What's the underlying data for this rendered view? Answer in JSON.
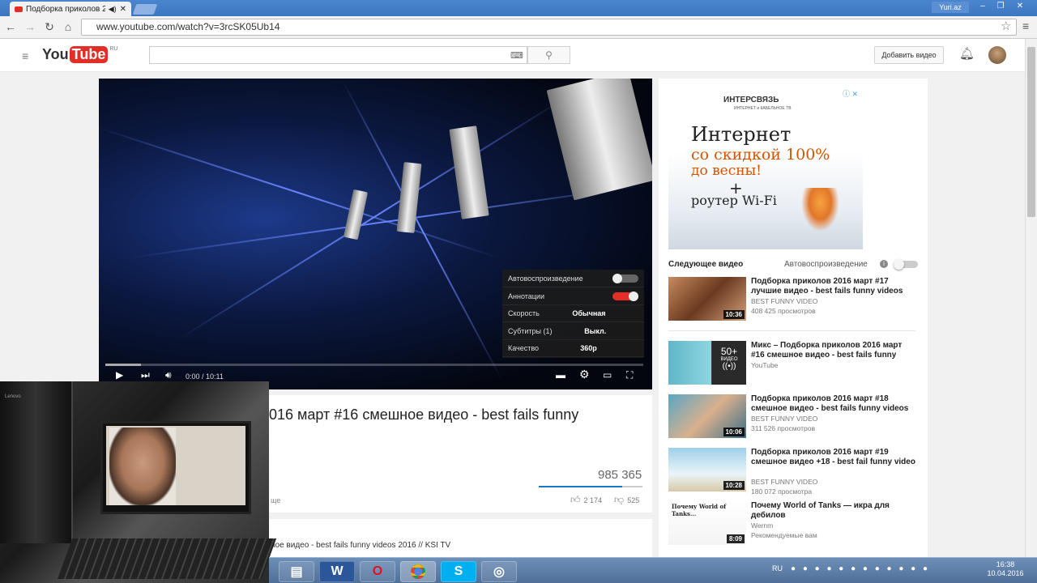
{
  "browser": {
    "tab_title": "Подборка приколов 2",
    "url": "www.youtube.com/watch?v=3rcSK05Ub14",
    "window_user": "Yuri.az"
  },
  "youtube": {
    "logo_you": "You",
    "logo_tube": "Tube",
    "logo_region": "RU",
    "search_placeholder": "",
    "upload_label": "Добавить видео"
  },
  "player": {
    "time": "0:00 / 10:11",
    "progress_fraction": 0.066,
    "settings": [
      {
        "label": "Автовоспроизведение",
        "value": "",
        "toggle": "off"
      },
      {
        "label": "Аннотации",
        "value": "",
        "toggle": "on"
      },
      {
        "label": "Скорость",
        "value": "Обычная",
        "toggle": ""
      },
      {
        "label": "Субтитры (1)",
        "value": "Выкл.",
        "toggle": ""
      },
      {
        "label": "Качество",
        "value": "360p",
        "toggle": ""
      }
    ]
  },
  "video": {
    "title_visible": "016 март #16 смешное видео - best fails funny",
    "views": "985 365",
    "likes": "2 174",
    "dislikes": "525",
    "like_fraction": 0.806,
    "more_label": "ще",
    "description_visible": "ное видео - best fails funny videos 2016 // KSI TV"
  },
  "ad": {
    "brand": "ИНТЕРСВЯЗЬ",
    "brand_sub": "ИНТЕРНЕТ и КАБЕЛЬНОЕ ТВ",
    "line1": "Интернет",
    "line2": "со скидкой 100%",
    "line3": "до  весны!",
    "line4": "+",
    "line5": "роутер Wi-Fi"
  },
  "sidebar": {
    "next_label": "Следующее видео",
    "autoplay_label": "Автовоспроизведение",
    "items": [
      {
        "title": "Подборка приколов 2016 март #17 лучшие видео - best fails funny videos",
        "channel": "BEST FUNNY VIDEO",
        "views": "408 425 просмотров",
        "duration": "10:36"
      },
      {
        "title": "Микс – Подборка приколов 2016 март #16 смешное видео - best fails funny",
        "channel": "YouTube",
        "views": "",
        "duration": "50+",
        "duration_sub": "ВИДЕО"
      },
      {
        "title": "Подборка приколов 2016 март #18 смешное видео - best fails funny videos",
        "channel": "BEST FUNNY VIDEO",
        "views": "311 526 просмотров",
        "duration": "10:06"
      },
      {
        "title": "Подборка приколов 2016 март #19 смешное видео +18 - best fail funny video",
        "channel": "BEST FUNNY VIDEO",
        "views": "180 072 просмотра",
        "duration": "10:28"
      },
      {
        "title": "Почему World of Tanks — икра для дебилов",
        "channel": "Wernm",
        "views": "Рекомендуемые вам",
        "duration": "8:09",
        "thumb_caption": "Почему World of Tanks..."
      }
    ]
  },
  "webcam": {
    "pc_label": "Lenovo"
  },
  "taskbar": {
    "lang": "RU",
    "time": "16:38",
    "date": "10.04.2016"
  }
}
